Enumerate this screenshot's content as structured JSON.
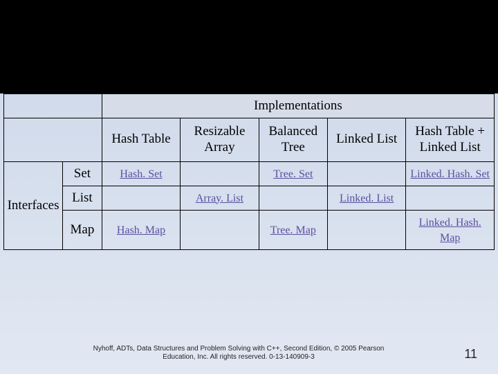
{
  "header": {
    "implementations": "Implementations"
  },
  "col_headers": {
    "hash_table": "Hash Table",
    "resizable_array": "Resizable Array",
    "balanced_tree": "Balanced Tree",
    "linked_list": "Linked List",
    "hash_plus_linked": "Hash Table + Linked List"
  },
  "row_group": {
    "interfaces": "Interfaces"
  },
  "rows": {
    "set": {
      "label": "Set",
      "hash_table": "Hash. Set",
      "resizable_array": "",
      "balanced_tree": "Tree. Set",
      "linked_list": "",
      "hash_plus_linked": "Linked. Hash. Set"
    },
    "list": {
      "label": "List",
      "hash_table": "",
      "resizable_array": "Array. List",
      "balanced_tree": "",
      "linked_list": "Linked. List",
      "hash_plus_linked": ""
    },
    "map": {
      "label": "Map",
      "hash_table": "Hash. Map",
      "resizable_array": "",
      "balanced_tree": "Tree. Map",
      "linked_list": "",
      "hash_plus_linked": "Linked. Hash. Map"
    }
  },
  "footer": {
    "citation": "Nyhoff, ADTs, Data Structures and Problem Solving with C++, Second Edition, © 2005 Pearson Education, Inc. All rights reserved. 0-13-140909-3",
    "page": "11"
  },
  "chart_data": {
    "type": "table",
    "title": "Implementations",
    "row_group_label": "Interfaces",
    "columns": [
      "Hash Table",
      "Resizable Array",
      "Balanced Tree",
      "Linked List",
      "Hash Table + Linked List"
    ],
    "rows": [
      {
        "interface": "Set",
        "cells": [
          "Hash. Set",
          "",
          "Tree. Set",
          "",
          "Linked. Hash. Set"
        ]
      },
      {
        "interface": "List",
        "cells": [
          "",
          "Array. List",
          "",
          "Linked. List",
          ""
        ]
      },
      {
        "interface": "Map",
        "cells": [
          "Hash. Map",
          "",
          "Tree. Map",
          "",
          "Linked. Hash. Map"
        ]
      }
    ]
  }
}
